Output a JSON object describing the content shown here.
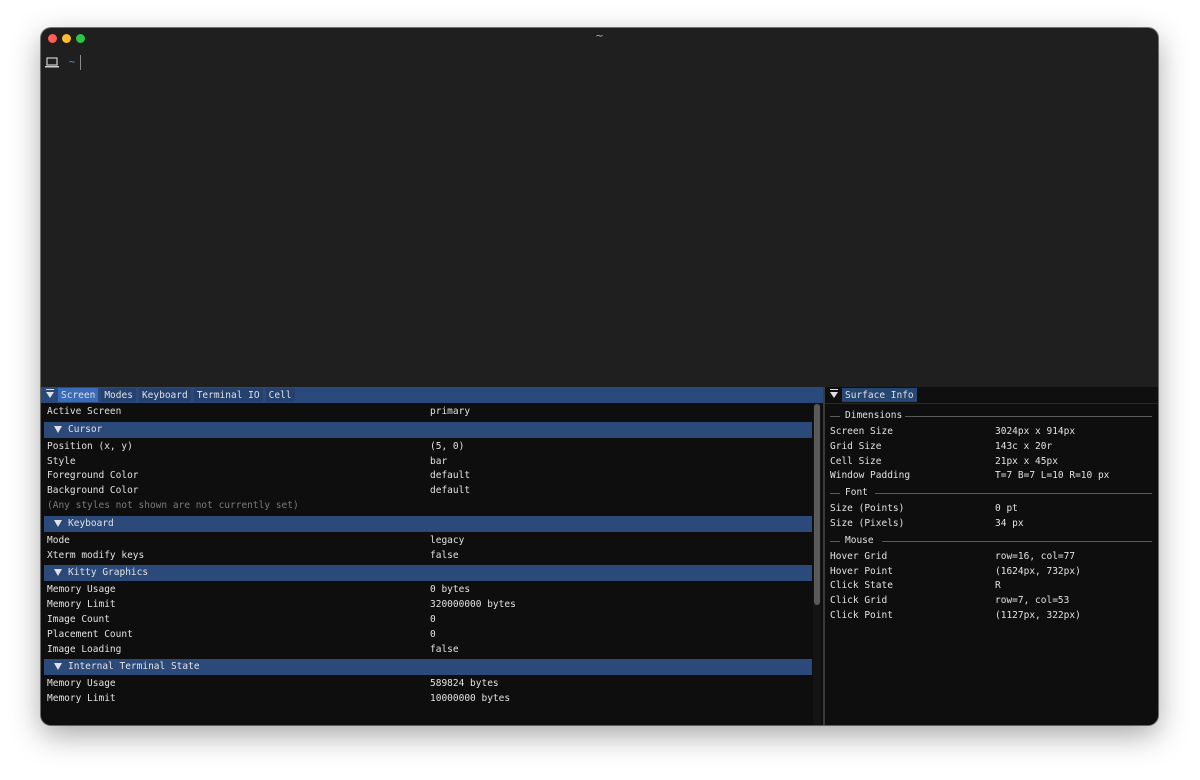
{
  "window": {
    "title": "~"
  },
  "prompt": {
    "dir": "~"
  },
  "left_panel": {
    "tabs": [
      "Screen",
      "Modes",
      "Keyboard",
      "Terminal IO",
      "Cell"
    ],
    "active_screen": {
      "label": "Active Screen",
      "value": "primary"
    },
    "cursor": {
      "title": "Cursor",
      "rows": [
        {
          "k": "Position (x, y)",
          "v": "(5, 0)"
        },
        {
          "k": "Style",
          "v": "bar"
        },
        {
          "k": "Foreground Color",
          "v": "default"
        },
        {
          "k": "Background Color",
          "v": "default"
        }
      ],
      "note": "(Any styles not shown are not currently set)"
    },
    "keyboard": {
      "title": "Keyboard",
      "rows": [
        {
          "k": "Mode",
          "v": "legacy"
        },
        {
          "k": "Xterm modify keys",
          "v": "false"
        }
      ]
    },
    "kitty": {
      "title": "Kitty Graphics",
      "rows": [
        {
          "k": "Memory Usage",
          "v": "0 bytes"
        },
        {
          "k": "Memory Limit",
          "v": "320000000 bytes"
        },
        {
          "k": "Image Count",
          "v": "0"
        },
        {
          "k": "Placement Count",
          "v": "0"
        },
        {
          "k": "Image Loading",
          "v": "false"
        }
      ]
    },
    "internal": {
      "title": "Internal Terminal State",
      "rows": [
        {
          "k": "Memory Usage",
          "v": "589824 bytes"
        },
        {
          "k": "Memory Limit",
          "v": "10000000 bytes"
        }
      ]
    }
  },
  "right_panel": {
    "tab": "Surface Info",
    "dimensions": {
      "title": "Dimensions",
      "rows": [
        {
          "k": "Screen Size",
          "v": "3024px x 914px"
        },
        {
          "k": "Grid Size",
          "v": "143c x 20r"
        },
        {
          "k": "Cell Size",
          "v": "21px x 45px"
        },
        {
          "k": "Window Padding",
          "v": "T=7 B=7 L=10 R=10 px"
        }
      ]
    },
    "font": {
      "title": "Font",
      "rows": [
        {
          "k": "Size (Points)",
          "v": "0 pt"
        },
        {
          "k": "Size (Pixels)",
          "v": "34 px"
        }
      ]
    },
    "mouse": {
      "title": "Mouse",
      "rows": [
        {
          "k": "Hover Grid",
          "v": "row=16, col=77"
        },
        {
          "k": "Hover Point",
          "v": "(1624px, 732px)"
        },
        {
          "k": "Click State",
          "v": "R"
        },
        {
          "k": "Click Grid",
          "v": "row=7, col=53"
        },
        {
          "k": "Click Point",
          "v": "(1127px, 322px)"
        }
      ]
    }
  }
}
